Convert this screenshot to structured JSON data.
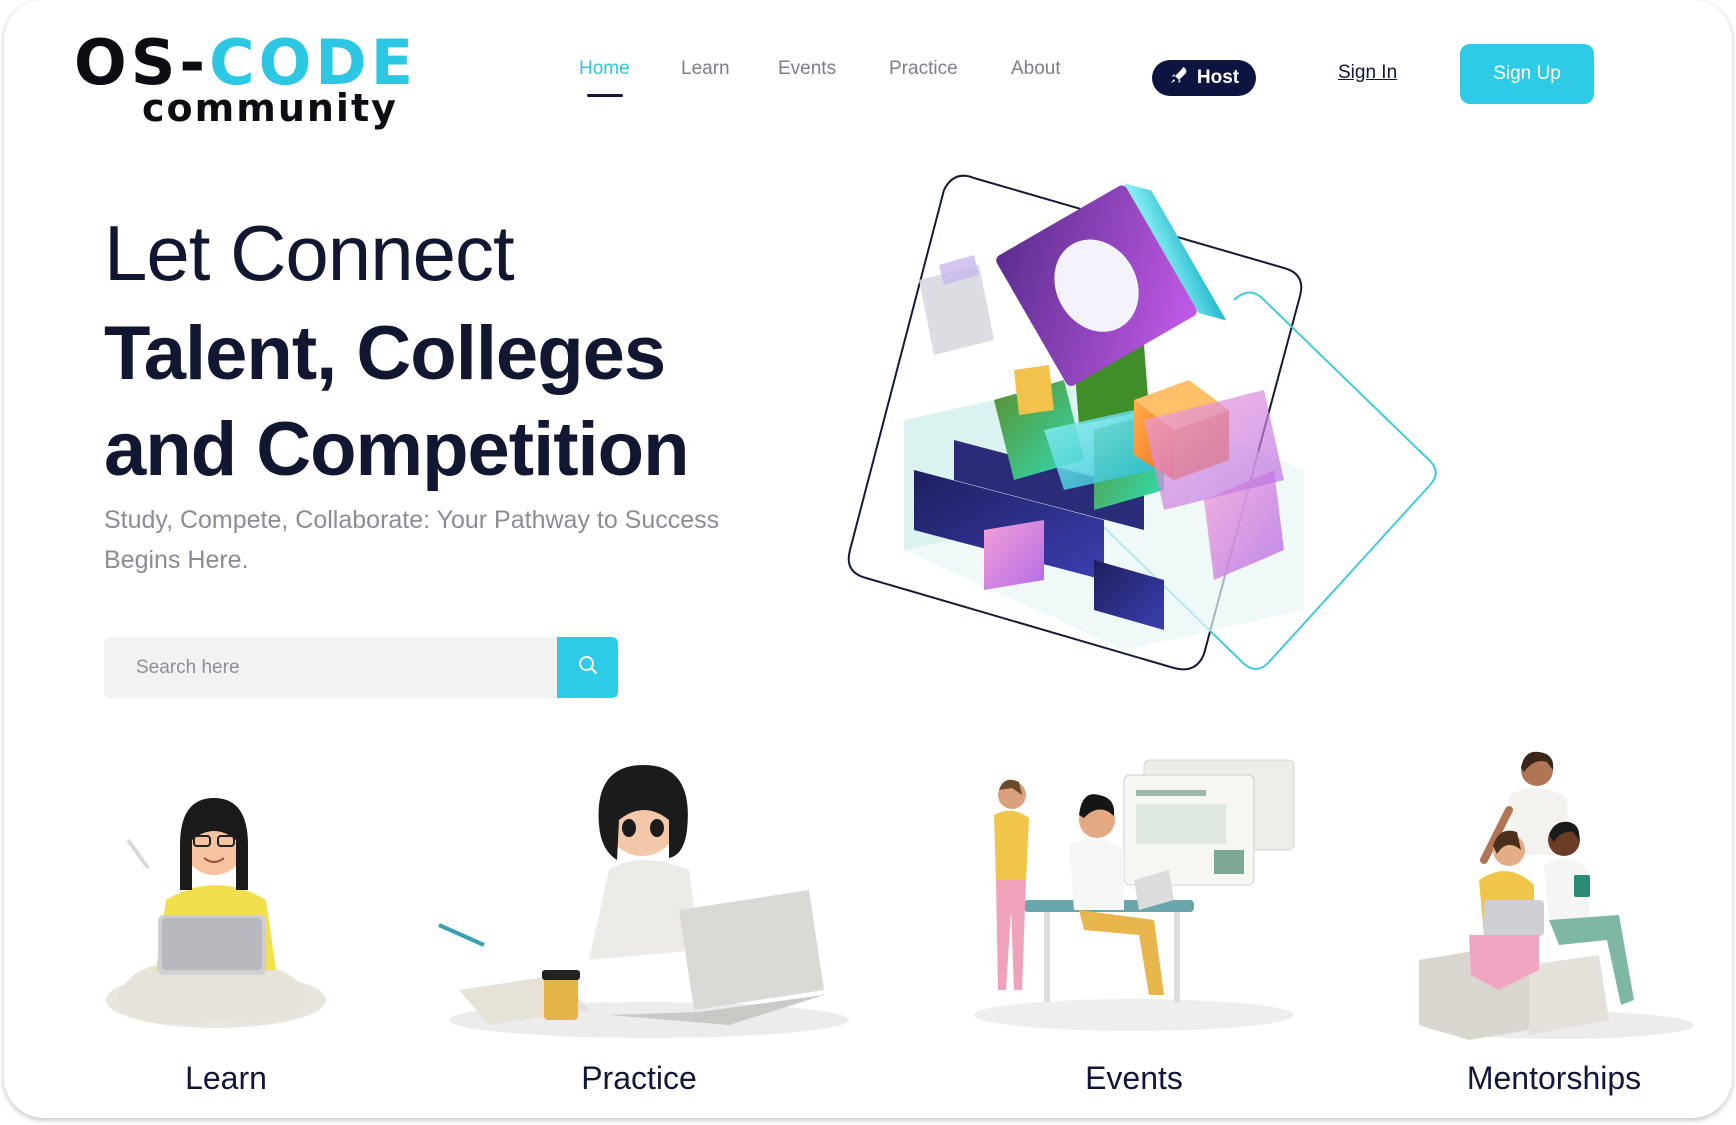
{
  "logo": {
    "line1_dark": "OS-",
    "line1_accent": "CODE",
    "line2": "community"
  },
  "nav": {
    "items": [
      {
        "label": "Home",
        "active": true
      },
      {
        "label": "Learn",
        "active": false
      },
      {
        "label": "Events",
        "active": false
      },
      {
        "label": "Practice",
        "active": false
      },
      {
        "label": "About",
        "active": false
      }
    ],
    "host_label": "Host",
    "signin_label": "Sign In",
    "signup_label": "Sign Up"
  },
  "hero": {
    "line1": "Let Connect",
    "line2": "Talent, Colleges",
    "line3": "and Competition",
    "subtitle": "Study, Compete, Collaborate: Your Pathway to Success Begins Here."
  },
  "search": {
    "placeholder": "Search here",
    "value": ""
  },
  "categories": [
    {
      "label": "Learn"
    },
    {
      "label": "Practice"
    },
    {
      "label": "Events"
    },
    {
      "label": "Mentorships"
    }
  ],
  "colors": {
    "accent": "#2dcbe5",
    "navy": "#111631",
    "muted": "#8a8d96"
  },
  "icons": {
    "host": "rocket-icon",
    "search": "search-icon"
  }
}
